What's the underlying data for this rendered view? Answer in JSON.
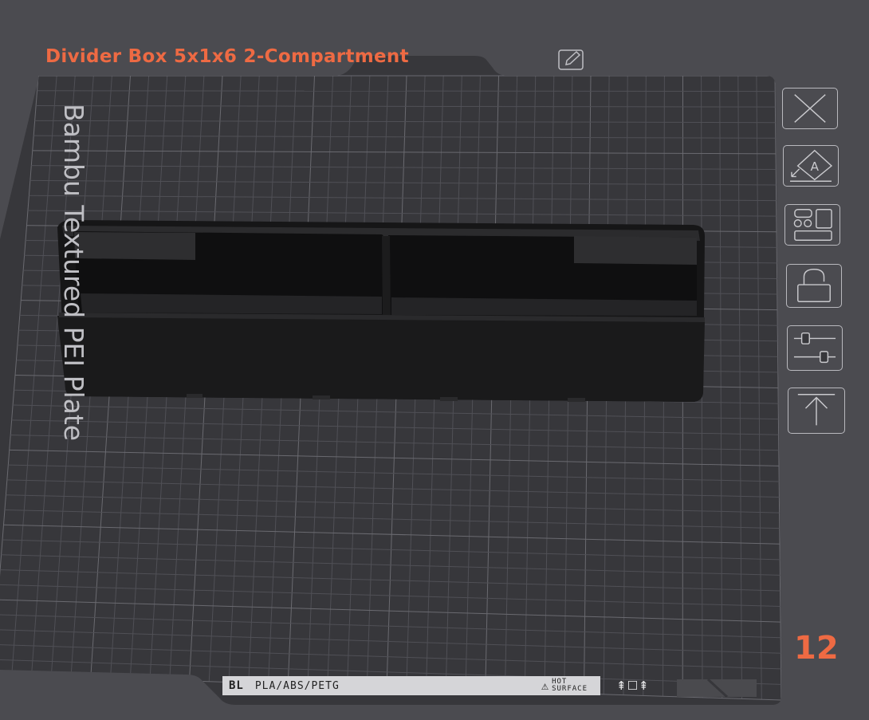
{
  "plate": {
    "title": "Divider Box 5x1x6 2-Compartment",
    "bed_label": "Bambu Textured PEI Plate",
    "number": "12"
  },
  "footer": {
    "logo": "BL",
    "materials": "PLA/ABS/PETG",
    "warning": "HOT\nSURFACE",
    "icons": "⇞☐⇞"
  },
  "toolbar": {
    "items": [
      {
        "name": "delete-plate-icon"
      },
      {
        "name": "auto-orient-icon"
      },
      {
        "name": "arrange-icon"
      },
      {
        "name": "lock-icon"
      },
      {
        "name": "plate-settings-icon"
      },
      {
        "name": "move-to-top-icon"
      }
    ]
  },
  "colors": {
    "background": "#4b4b50",
    "plate": "#37373b",
    "grid": "#5a5a60",
    "accent": "#ee6a43",
    "model": "#1a1a1b"
  }
}
